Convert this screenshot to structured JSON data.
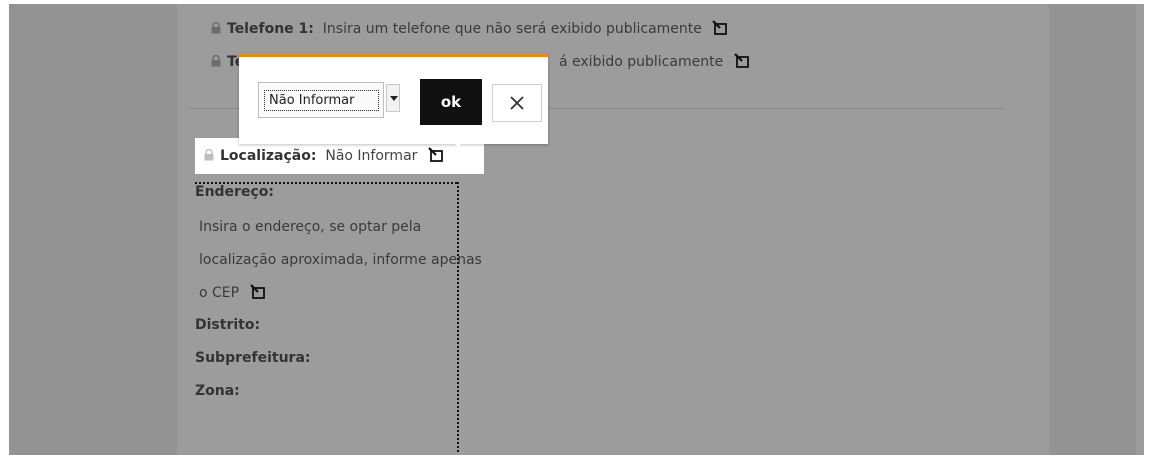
{
  "contact": {
    "phone1_label": "Telefone 1:",
    "phone1_value": "Insira um telefone que não será exibido publicamente",
    "phone2_label_visible": "Te",
    "phone2_value_visible": "á exibido publicamente"
  },
  "location": {
    "label": "Localização:",
    "value": "Não Informar"
  },
  "address": {
    "label": "Endereço:",
    "lines": [
      "Insira o endereço, se optar pela",
      "localização aproximada, informe apenas",
      "o CEP"
    ]
  },
  "fields": {
    "district": "Distrito:",
    "subprefecture": "Subprefeitura:",
    "zone": "Zona:"
  },
  "popup": {
    "selected_option": "Não Informar",
    "ok_label": "ok",
    "accent_color": "#e68a1a"
  },
  "icons": {
    "lock": "lock-icon",
    "edit": "edit-icon",
    "close": "close-icon",
    "dropdown": "chevron-down-icon"
  }
}
